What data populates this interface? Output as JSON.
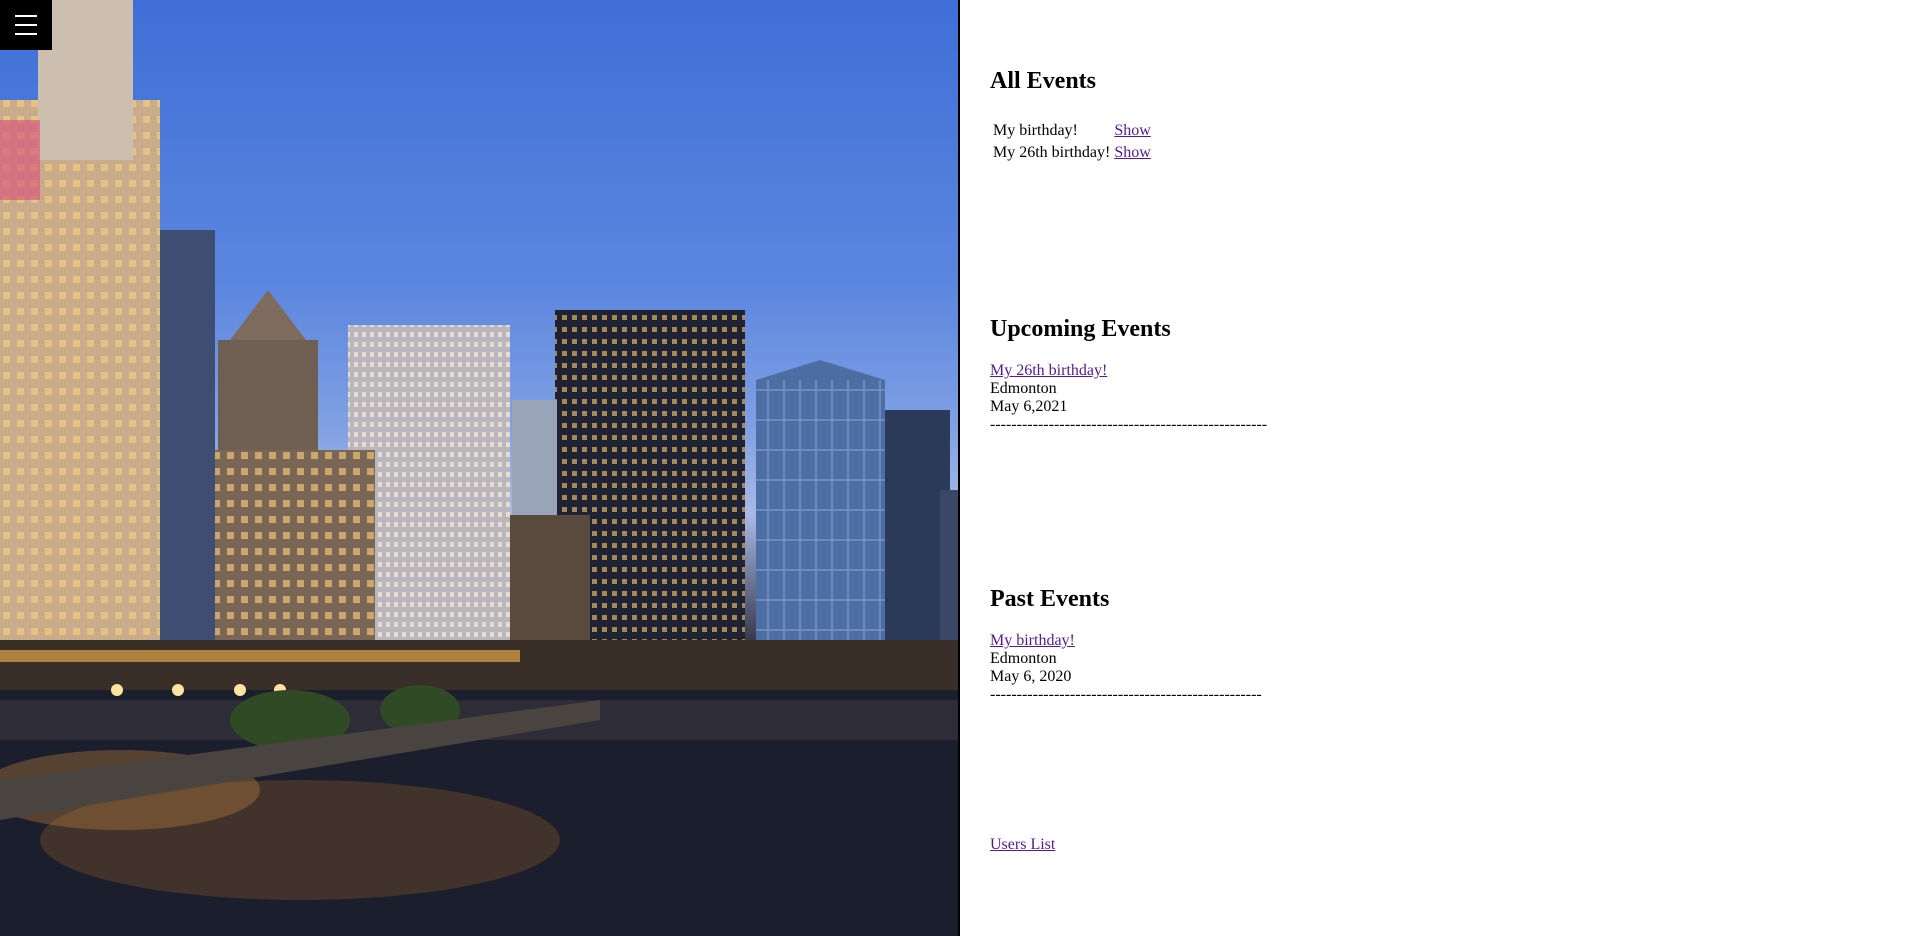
{
  "menu": {
    "icon": "hamburger-menu-icon"
  },
  "hero": {
    "scene": "city-skyline-river-dusk"
  },
  "all_events": {
    "heading": "All Events",
    "rows": [
      {
        "name": "My birthday!",
        "action": "Show"
      },
      {
        "name": "My 26th birthday!",
        "action": "Show"
      }
    ]
  },
  "upcoming_events": {
    "heading": "Upcoming Events",
    "items": [
      {
        "title": "My 26th birthday!",
        "location": "Edmonton",
        "date": "May 6,2021",
        "separator": "----------------------------------------------------"
      }
    ]
  },
  "past_events": {
    "heading": "Past Events",
    "items": [
      {
        "title": "My birthday!",
        "location": "Edmonton",
        "date": "May 6, 2020",
        "separator": "---------------------------------------------------"
      }
    ]
  },
  "footer": {
    "users_link": "Users List"
  },
  "colors": {
    "link": "#551a8b",
    "menu_bg": "#000000",
    "sky_top": "#3f6fd6"
  }
}
